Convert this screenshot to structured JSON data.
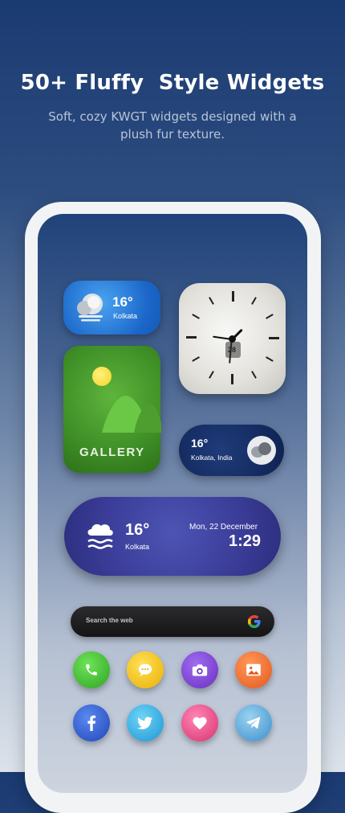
{
  "header": {
    "title": "50+ Fluffy  Style Widgets",
    "subtitle": "Soft, cozy KWGT widgets designed with a plush fur texture."
  },
  "widgets": {
    "weather_small": {
      "temp": "16°",
      "city": "Kolkata"
    },
    "clock": {
      "date_num": "28"
    },
    "gallery": {
      "label": "GALLERY"
    },
    "weather_pill": {
      "temp": "16°",
      "location": "Kolkata, India"
    },
    "weather_big": {
      "temp": "16°",
      "city": "Kolkata",
      "date": "Mon, 22 December",
      "time": "1:29"
    },
    "search": {
      "placeholder": "Search the web"
    }
  },
  "apps_row1": [
    "phone-icon",
    "messages-icon",
    "camera-icon",
    "gallery-icon"
  ],
  "apps_row2": [
    "facebook-icon",
    "twitter-icon",
    "heart-icon",
    "telegram-icon"
  ],
  "colors": {
    "phone": "#3fbf34",
    "messages": "#f2c21b",
    "camera": "#7a3fd0",
    "gallery": "#f06e2a",
    "facebook": "#2d5fd6",
    "twitter": "#2fb1e8",
    "heart": "#e64a8a",
    "telegram": "#4aa6dd"
  }
}
